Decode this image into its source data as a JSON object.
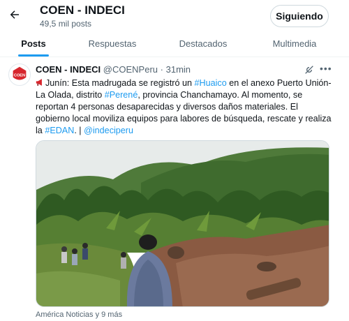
{
  "header": {
    "back_icon": "arrow-left-icon",
    "title": "COEN - INDECI",
    "post_count": "49,5 mil posts",
    "follow_label": "Siguiendo"
  },
  "tabs": [
    {
      "label": "Posts",
      "active": true
    },
    {
      "label": "Respuestas",
      "active": false
    },
    {
      "label": "Destacados",
      "active": false
    },
    {
      "label": "Multimedia",
      "active": false
    }
  ],
  "tweet": {
    "avatar_text": "COEN",
    "name": "COEN - INDECI",
    "handle": "@COENPeru",
    "separator": "·",
    "time": "31min",
    "grok_icon": "grok-icon",
    "more_icon": "more-horizontal-icon",
    "text": {
      "t1": "Junín: Esta madrugada se registró un ",
      "tag1": "#Huaico",
      "t2": " en el anexo Puerto Unión-La Olada, distrito ",
      "tag2": "#Perené",
      "t3": ", provincia Chanchamayo. Al momento, se reportan 4 personas desaparecidas y diversos daños materiales. El gobierno local moviliza equipos para labores de búsqueda, rescate y realiza la ",
      "tag3": "#EDAN",
      "t4": ". | ",
      "mention": "@indeciperu"
    },
    "media_alt": "landslide photo",
    "source": "América Noticias y 9 más"
  },
  "colors": {
    "accent": "#1d9bf0",
    "muted": "#536471",
    "brand_red": "#d7262d"
  }
}
